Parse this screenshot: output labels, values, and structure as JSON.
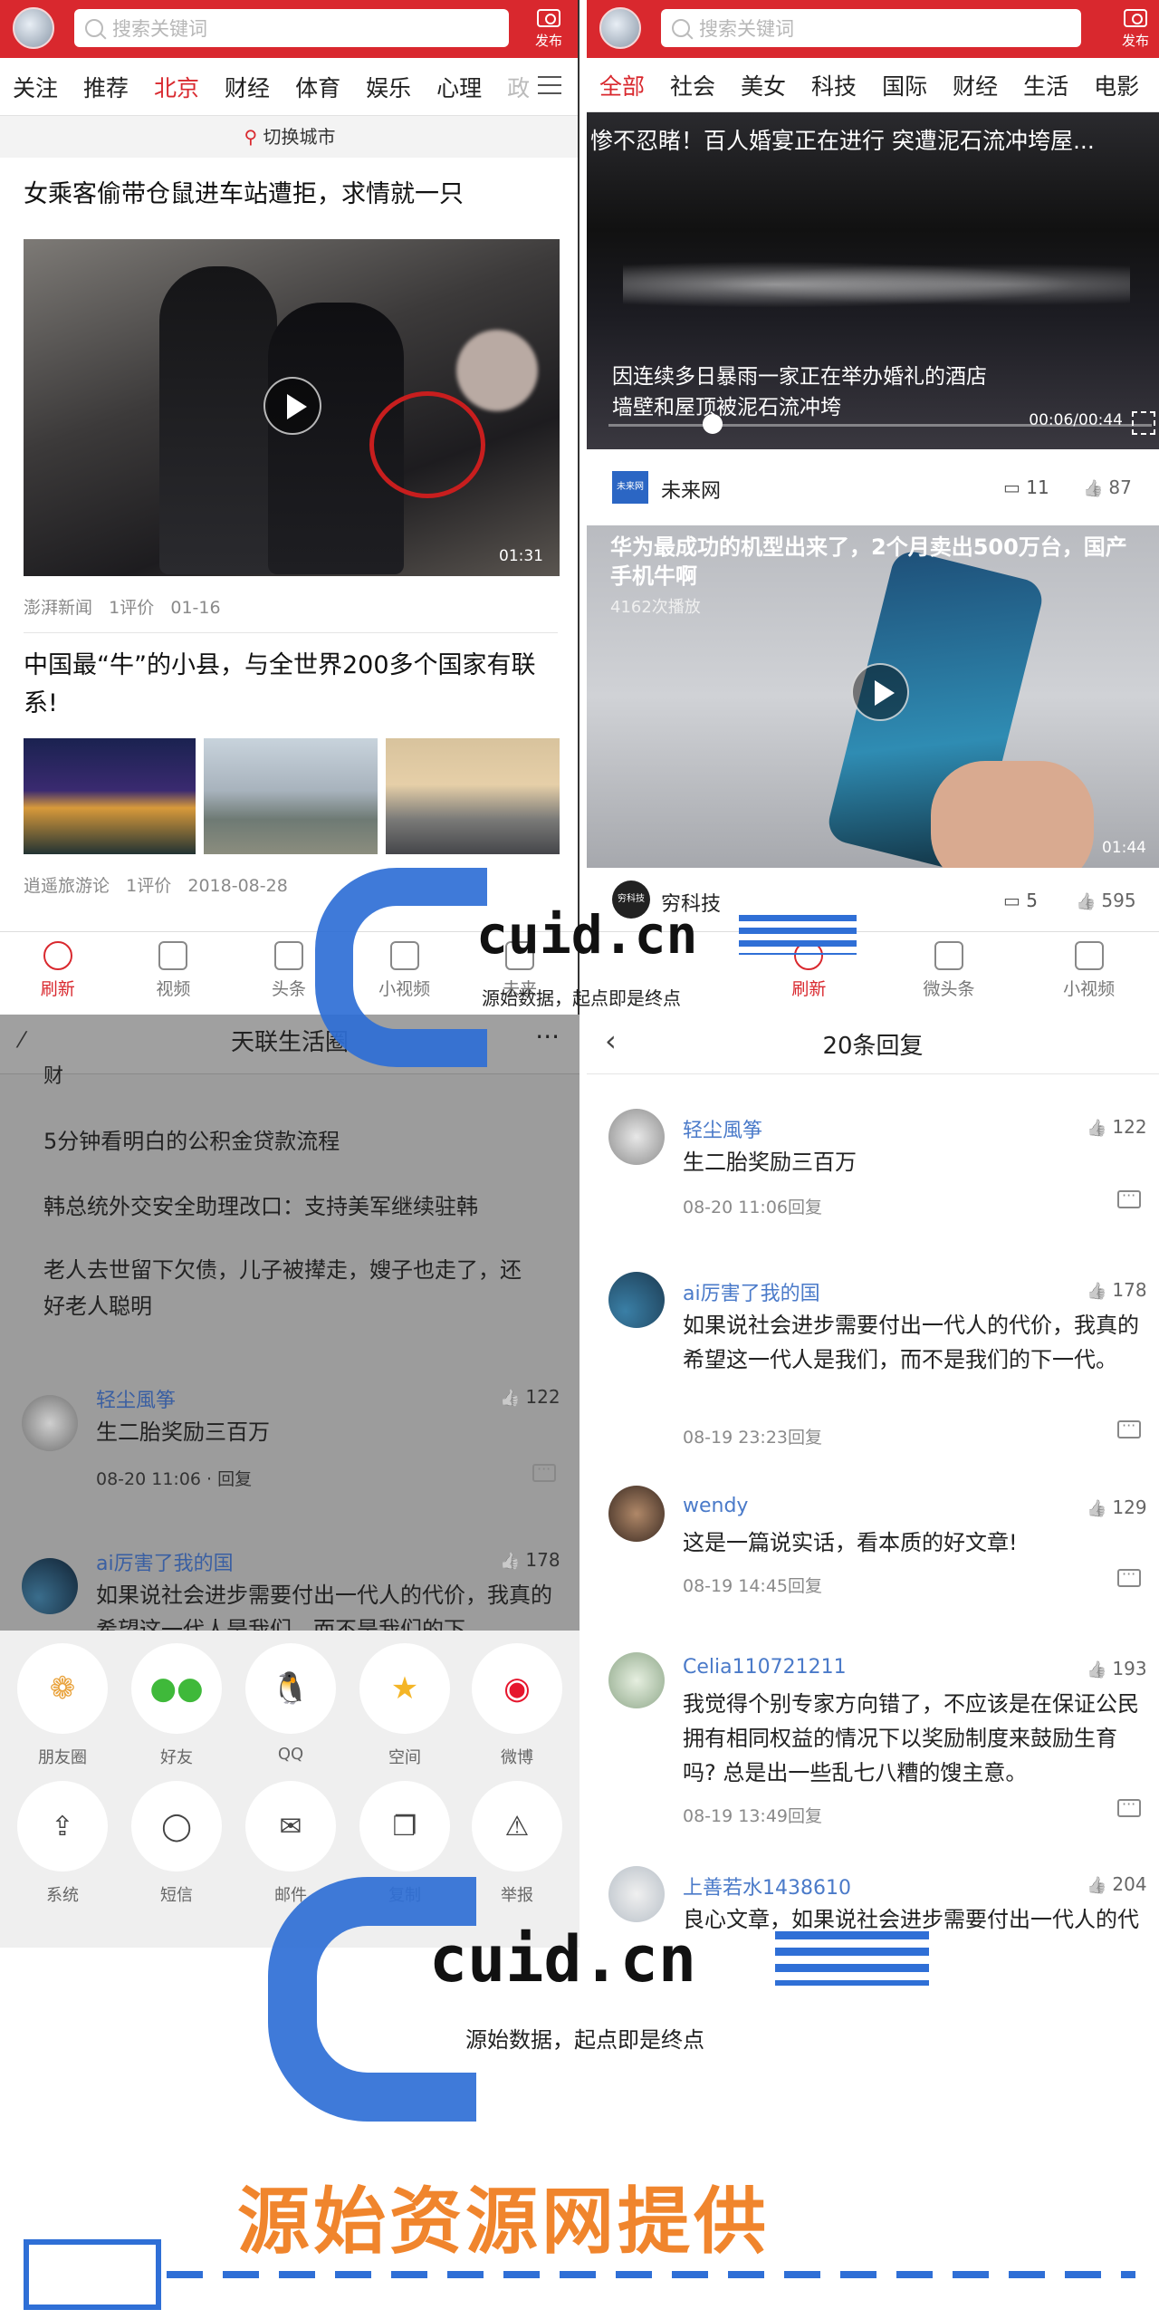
{
  "panel_a": {
    "search_placeholder": "搜索关键词",
    "publish_label": "发布",
    "channels": [
      "关注",
      "推荐",
      "北京",
      "财经",
      "体育",
      "娱乐",
      "心理",
      "政"
    ],
    "switch_city": "切换城市",
    "article1": {
      "title": "女乘客偷带仓鼠进车站遭拒，求情就一只",
      "duration": "01:31",
      "source": "澎湃新闻",
      "comments": "1评价",
      "date": "01-16"
    },
    "article2": {
      "title": "中国最“牛”的小县，与全世界200多个国家有联系!",
      "source": "逍遥旅游论",
      "comments": "1评价",
      "date": "2018-08-28"
    },
    "tabs": [
      "刷新",
      "视频",
      "头条",
      "小视频",
      "未来"
    ]
  },
  "panel_b": {
    "search_placeholder": "搜索关键词",
    "publish_label": "发布",
    "channels": [
      "全部",
      "社会",
      "美女",
      "科技",
      "国际",
      "财经",
      "生活",
      "电影"
    ],
    "video1": {
      "title": "惨不忍睹！百人婚宴正在进行 突遭泥石流冲垮屋...",
      "caption1": "因连续多日暴雨一家正在举办婚礼的酒店",
      "caption2": "墙壁和屋顶被泥石流冲垮",
      "time": "00:06/00:44",
      "source_badge": "未来网",
      "source": "未来网",
      "comments": "11",
      "likes": "87"
    },
    "video2": {
      "title": "华为最成功的机型出来了，2个月卖出500万台，国产手机牛啊",
      "plays": "4162次播放",
      "duration": "01:44",
      "source_badge": "穷科技",
      "source": "穷科技",
      "comments": "5",
      "likes": "595"
    },
    "tabs": [
      "刷新",
      "微头条",
      "小视频"
    ]
  },
  "panel_c": {
    "header_title": "天联生活圈",
    "more": "···",
    "list": [
      "财",
      "5分钟看明白的公积金贷款流程",
      "韩总统外交安全助理改口：支持美军继续驻韩",
      "老人去世留下欠债，儿子被撵走，嫂子也走了，还好老人聪明"
    ],
    "comments": [
      {
        "name": "轻尘風筝",
        "text": "生二胎奖励三百万",
        "time": "08-20 11:06 · 回复",
        "likes": "122"
      },
      {
        "name": "ai厉害了我的国",
        "text": "如果说社会进步需要付出一代人的代价，我真的希望这一代人是我们，而不是我们的下",
        "likes": "178"
      }
    ],
    "share_row1": [
      "朋友圈",
      "好友",
      "QQ",
      "空间",
      "微博"
    ],
    "share_row2": [
      "系统",
      "短信",
      "邮件",
      "复制",
      "举报"
    ]
  },
  "panel_d": {
    "header_title": "20条回复",
    "comments": [
      {
        "name": "轻尘風筝",
        "text": "生二胎奖励三百万",
        "time": "08-20 11:06回复",
        "likes": "122"
      },
      {
        "name": "ai厉害了我的国",
        "text": "如果说社会进步需要付出一代人的代价，我真的希望这一代人是我们，而不是我们的下一代。",
        "time": "08-19 23:23回复",
        "likes": "178"
      },
      {
        "name": "wendy",
        "text": "这是一篇说实话，看本质的好文章!",
        "time": "08-19 14:45回复",
        "likes": "129"
      },
      {
        "name": "Celia110721211",
        "text": "我觉得个别专家方向错了，不应该是在保证公民拥有相同权益的情况下以奖励制度来鼓励生育吗? 总是出一些乱七八糟的馊主意。",
        "time": "08-19 13:49回复",
        "likes": "193"
      },
      {
        "name": "上善若水1438610",
        "text": "良心文章，如果说社会进步需要付出一代人的代",
        "likes": "204"
      }
    ]
  },
  "watermark": {
    "brand": "cuid.cn",
    "slogan": "源始数据，起点即是终点"
  },
  "footer": {
    "provider": "源始资源网提供"
  },
  "colors": {
    "brand_red": "#d9282e",
    "link_blue": "#4a7ac9",
    "watermark_blue": "#2f6fd6",
    "footer_orange": "#f0852d"
  }
}
